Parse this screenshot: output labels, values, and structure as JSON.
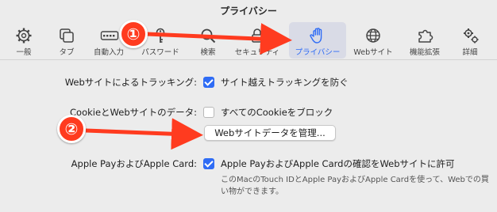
{
  "window": {
    "title": "プライバシー"
  },
  "toolbar": {
    "items": [
      {
        "label": "一般",
        "icon": "gear-icon"
      },
      {
        "label": "タブ",
        "icon": "tabs-icon"
      },
      {
        "label": "自動入力",
        "icon": "autofill-icon"
      },
      {
        "label": "パスワード",
        "icon": "key-icon"
      },
      {
        "label": "検索",
        "icon": "search-icon"
      },
      {
        "label": "セキュリティ",
        "icon": "lock-icon"
      },
      {
        "label": "プライバシー",
        "icon": "hand-icon",
        "active": true
      },
      {
        "label": "Webサイト",
        "icon": "globe-icon"
      },
      {
        "label": "機能拡張",
        "icon": "puzzle-icon"
      },
      {
        "label": "詳細",
        "icon": "gears-icon"
      }
    ]
  },
  "privacy": {
    "tracking": {
      "label": "Webサイトによるトラッキング:",
      "option": "サイト越えトラッキングを防ぐ",
      "checked": true
    },
    "cookies": {
      "label": "CookieとWebサイトのデータ:",
      "option": "すべてのCookieをブロック",
      "checked": false,
      "manage_button": "Webサイトデータを管理..."
    },
    "applepay": {
      "label": "Apple PayおよびApple Card:",
      "option": "Apple PayおよびApple Cardの確認をWebサイトに許可",
      "checked": true,
      "note": "このMacのTouch IDとApple PayおよびApple Cardを使って、Webでの買い物ができます。"
    }
  },
  "annotations": {
    "badge1": "①",
    "badge2": "②",
    "color": "#ff3b1f"
  },
  "colors": {
    "accent": "#2f6cf5",
    "background": "#ececec"
  }
}
